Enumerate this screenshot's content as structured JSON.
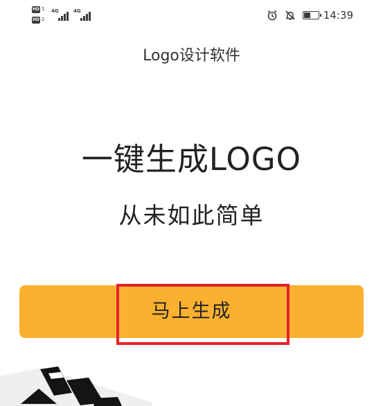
{
  "status_bar": {
    "hd_badge": "HD",
    "sim_slot_1": "1",
    "sim_slot_2": "2",
    "network_1": "4G",
    "network_2": "4G",
    "battery_level": 0.45,
    "time": "14:39",
    "icons": [
      "alarm-icon",
      "notifications-off-icon",
      "battery-icon"
    ]
  },
  "app": {
    "title": "Logo设计软件"
  },
  "hero": {
    "headline": "一键生成LOGO",
    "subheadline": "从未如此简单"
  },
  "actions": {
    "generate_label": "马上生成"
  },
  "colors": {
    "button": "#fbb12f",
    "highlight": "#e8202c",
    "text": "#222222"
  }
}
